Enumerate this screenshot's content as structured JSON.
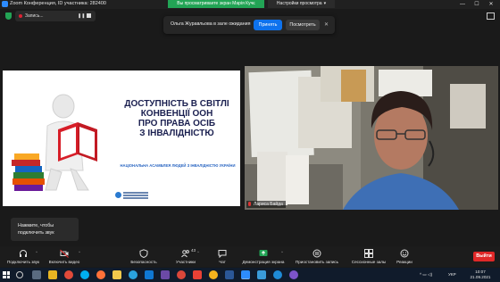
{
  "window": {
    "title": "Zoom Конференция, ID участника: 282400",
    "share_banner": "Вы просматриваете экран Марія Кучє",
    "view_settings": "Настройки просмотра",
    "controls": [
      "—",
      "☐",
      "✕"
    ]
  },
  "recording": {
    "label": "Запись...",
    "pause": "❚❚"
  },
  "notification": {
    "text": "Ольга Журавльова в зале ожидания",
    "admit": "Принять",
    "view": "Посмотреть",
    "close": "✕"
  },
  "slide": {
    "title_lines": [
      "ДОСТУПНІСТЬ В СВІТЛІ",
      "КОНВЕНЦІЇ ООН",
      "ПРО ПРАВА ОСІБ",
      "З ІНВАЛІДНІСТЮ"
    ],
    "subtitle": "НАЦІОНАЛЬНА АСАМБЛЕЯ ЛЮДЕЙ З ІНВАЛІДНІСТЮ УКРАЇНИ"
  },
  "video": {
    "participant_name": "Лариса Байда"
  },
  "tooltip": {
    "line1": "Нажмите, чтобы",
    "line2": "подключить звук"
  },
  "toolbar": {
    "items": [
      {
        "id": "audio",
        "label": "Подключить звук",
        "icon": "headphones-icon"
      },
      {
        "id": "video",
        "label": "Включить видео",
        "icon": "video-off-icon"
      },
      {
        "id": "security",
        "label": "Безопасность",
        "icon": "shield-icon"
      },
      {
        "id": "participants",
        "label": "Участники",
        "icon": "participants-icon",
        "count": "43"
      },
      {
        "id": "chat",
        "label": "Чат",
        "icon": "chat-icon"
      },
      {
        "id": "share",
        "label": "Демонстрация экрана",
        "icon": "share-screen-icon"
      },
      {
        "id": "record",
        "label": "Приостановить запись",
        "icon": "pause-record-icon"
      },
      {
        "id": "rooms",
        "label": "Сессионные залы",
        "icon": "breakout-rooms-icon"
      },
      {
        "id": "reactions",
        "label": "Реакции",
        "icon": "reactions-icon"
      }
    ],
    "end_label": "Выйти"
  },
  "taskbar": {
    "lang": "УКР",
    "time": "10:07",
    "date": "21.09.2021",
    "apps": [
      "search-icon",
      "task-view-icon",
      "explorer-icon",
      "chrome-icon",
      "skype-icon",
      "firefox-icon",
      "file-manager-icon",
      "telegram-icon",
      "outlook-icon",
      "photos-icon",
      "chrome-alt-icon",
      "word-icon",
      "zoom-icon",
      "app-icon",
      "app-icon",
      "app-icon",
      "edge-icon",
      "viber-icon"
    ],
    "colors": {
      "zoom_blue": "#2d8cff",
      "green": "#22a455",
      "red": "#e02828"
    }
  }
}
